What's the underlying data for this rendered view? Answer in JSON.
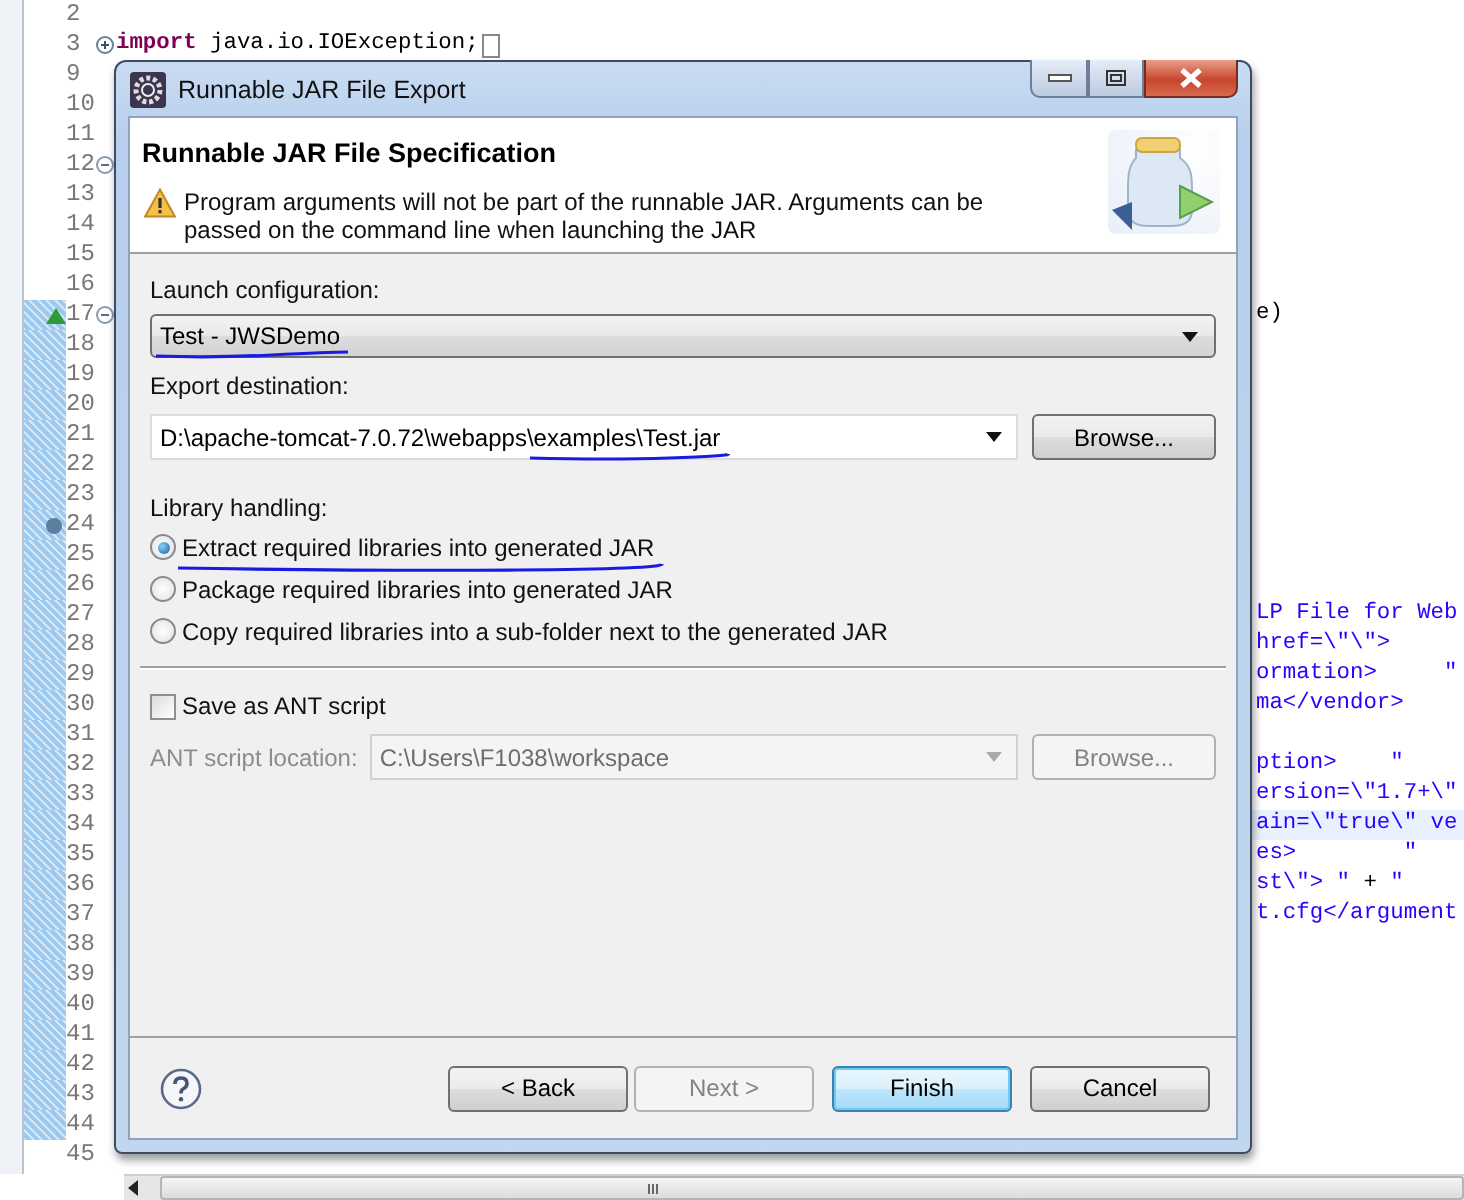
{
  "editor": {
    "lines": [
      {
        "number": "2",
        "changed": false,
        "current": false
      },
      {
        "number": "3",
        "changed": false,
        "current": false,
        "icons": [
          {
            "kind": "expand"
          }
        ],
        "segments": [
          {
            "text": "import",
            "kind": "keyword"
          },
          {
            "text": " java.io.IOException;",
            "kind": "plain"
          }
        ]
      },
      {
        "number": "9",
        "changed": false,
        "current": false
      },
      {
        "number": "10",
        "changed": false,
        "current": false
      },
      {
        "number": "11",
        "changed": false,
        "current": false
      },
      {
        "number": "12",
        "changed": false,
        "current": false,
        "icons": [
          {
            "kind": "collapse"
          }
        ]
      },
      {
        "number": "13",
        "changed": false,
        "current": false
      },
      {
        "number": "14",
        "changed": false,
        "current": false
      },
      {
        "number": "15",
        "changed": false,
        "current": false
      },
      {
        "number": "16",
        "changed": false,
        "current": false
      },
      {
        "number": "17",
        "changed": true,
        "current": false,
        "icons": [
          {
            "kind": "override"
          },
          {
            "kind": "collapse"
          }
        ],
        "tail": true,
        "segments": [
          {
            "text": "e)",
            "kind": "plain"
          }
        ]
      },
      {
        "number": "18",
        "changed": true,
        "current": false
      },
      {
        "number": "19",
        "changed": true,
        "current": false
      },
      {
        "number": "20",
        "changed": true,
        "current": false
      },
      {
        "number": "21",
        "changed": true,
        "current": false
      },
      {
        "number": "22",
        "changed": true,
        "current": false
      },
      {
        "number": "23",
        "changed": true,
        "current": false
      },
      {
        "number": "24",
        "changed": true,
        "current": false,
        "icons": [
          {
            "kind": "breakpoint"
          }
        ]
      },
      {
        "number": "25",
        "changed": true,
        "current": false
      },
      {
        "number": "26",
        "changed": true,
        "current": false
      },
      {
        "number": "27",
        "changed": true,
        "current": false,
        "tail": true,
        "segments": [
          {
            "text": "LP File for Web",
            "kind": "string"
          }
        ]
      },
      {
        "number": "28",
        "changed": true,
        "current": false,
        "tail": true,
        "segments": [
          {
            "text": "href=\\\"\\\">",
            "kind": "string"
          }
        ]
      },
      {
        "number": "29",
        "changed": true,
        "current": false,
        "tail": true,
        "segments": [
          {
            "text": "ormation>     \"",
            "kind": "string"
          }
        ]
      },
      {
        "number": "30",
        "changed": true,
        "current": false,
        "tail": true,
        "segments": [
          {
            "text": "ma</vendor>",
            "kind": "string"
          }
        ]
      },
      {
        "number": "31",
        "changed": true,
        "current": false
      },
      {
        "number": "32",
        "changed": true,
        "current": false,
        "tail": true,
        "segments": [
          {
            "text": "ption>    \"",
            "kind": "string"
          }
        ]
      },
      {
        "number": "33",
        "changed": true,
        "current": false,
        "tail": true,
        "segments": [
          {
            "text": "ersion=\\\"1.7+\\\"",
            "kind": "string"
          }
        ]
      },
      {
        "number": "34",
        "changed": true,
        "current": true,
        "tail": true,
        "segments": [
          {
            "text": "ain=\\\"true\\\" ve",
            "kind": "string"
          }
        ]
      },
      {
        "number": "35",
        "changed": true,
        "current": false,
        "tail": true,
        "segments": [
          {
            "text": "es>        \"",
            "kind": "string"
          }
        ]
      },
      {
        "number": "36",
        "changed": true,
        "current": false,
        "tail": true,
        "segments": [
          {
            "text": "st\\\"> \"",
            "kind": "string"
          },
          {
            "text": " + ",
            "kind": "plain"
          },
          {
            "text": "\"",
            "kind": "string"
          }
        ]
      },
      {
        "number": "37",
        "changed": true,
        "current": false,
        "tail": true,
        "segments": [
          {
            "text": "t.cfg</argument",
            "kind": "string"
          }
        ]
      },
      {
        "number": "38",
        "changed": true,
        "current": false
      },
      {
        "number": "39",
        "changed": true,
        "current": false
      },
      {
        "number": "40",
        "changed": true,
        "current": false
      },
      {
        "number": "41",
        "changed": true,
        "current": false
      },
      {
        "number": "42",
        "changed": true,
        "current": false
      },
      {
        "number": "43",
        "changed": true,
        "current": false
      },
      {
        "number": "44",
        "changed": true,
        "current": false
      },
      {
        "number": "45",
        "changed": false,
        "current": false
      }
    ]
  },
  "dialog": {
    "title": "Runnable JAR File Export",
    "header": {
      "title": "Runnable JAR File Specification",
      "message": "Program arguments will not be part of the runnable JAR. Arguments can be passed on the command line when launching the JAR"
    },
    "launch": {
      "label": "Launch configuration:",
      "value": "Test - JWSDemo",
      "ink_underline": true
    },
    "destination": {
      "label": "Export destination:",
      "value": "D:\\apache-tomcat-7.0.72\\webapps\\examples\\Test.jar",
      "ink_underline": true,
      "browse": {
        "label": "Browse...",
        "disabled": false
      }
    },
    "library": {
      "label": "Library handling:",
      "options": [
        {
          "label": "Extract required libraries into generated JAR",
          "selected": true,
          "ink_underline": true
        },
        {
          "label": "Package required libraries into generated JAR",
          "selected": false,
          "ink_underline": false
        },
        {
          "label": "Copy required libraries into a sub-folder next to the generated JAR",
          "selected": false,
          "ink_underline": false
        }
      ]
    },
    "ant": {
      "label": "Save as ANT script",
      "checked": false,
      "location_label": "ANT script location:",
      "location_value": "C:\\Users\\F1038\\workspace",
      "disabled": true,
      "browse": {
        "label": "Browse...",
        "disabled": true
      }
    },
    "buttons": [
      {
        "label": "< Back",
        "disabled": false,
        "default": false
      },
      {
        "label": "Next >",
        "disabled": true,
        "default": false
      },
      {
        "label": "Finish",
        "disabled": false,
        "default": true
      },
      {
        "label": "Cancel",
        "disabled": false,
        "default": false
      }
    ]
  }
}
